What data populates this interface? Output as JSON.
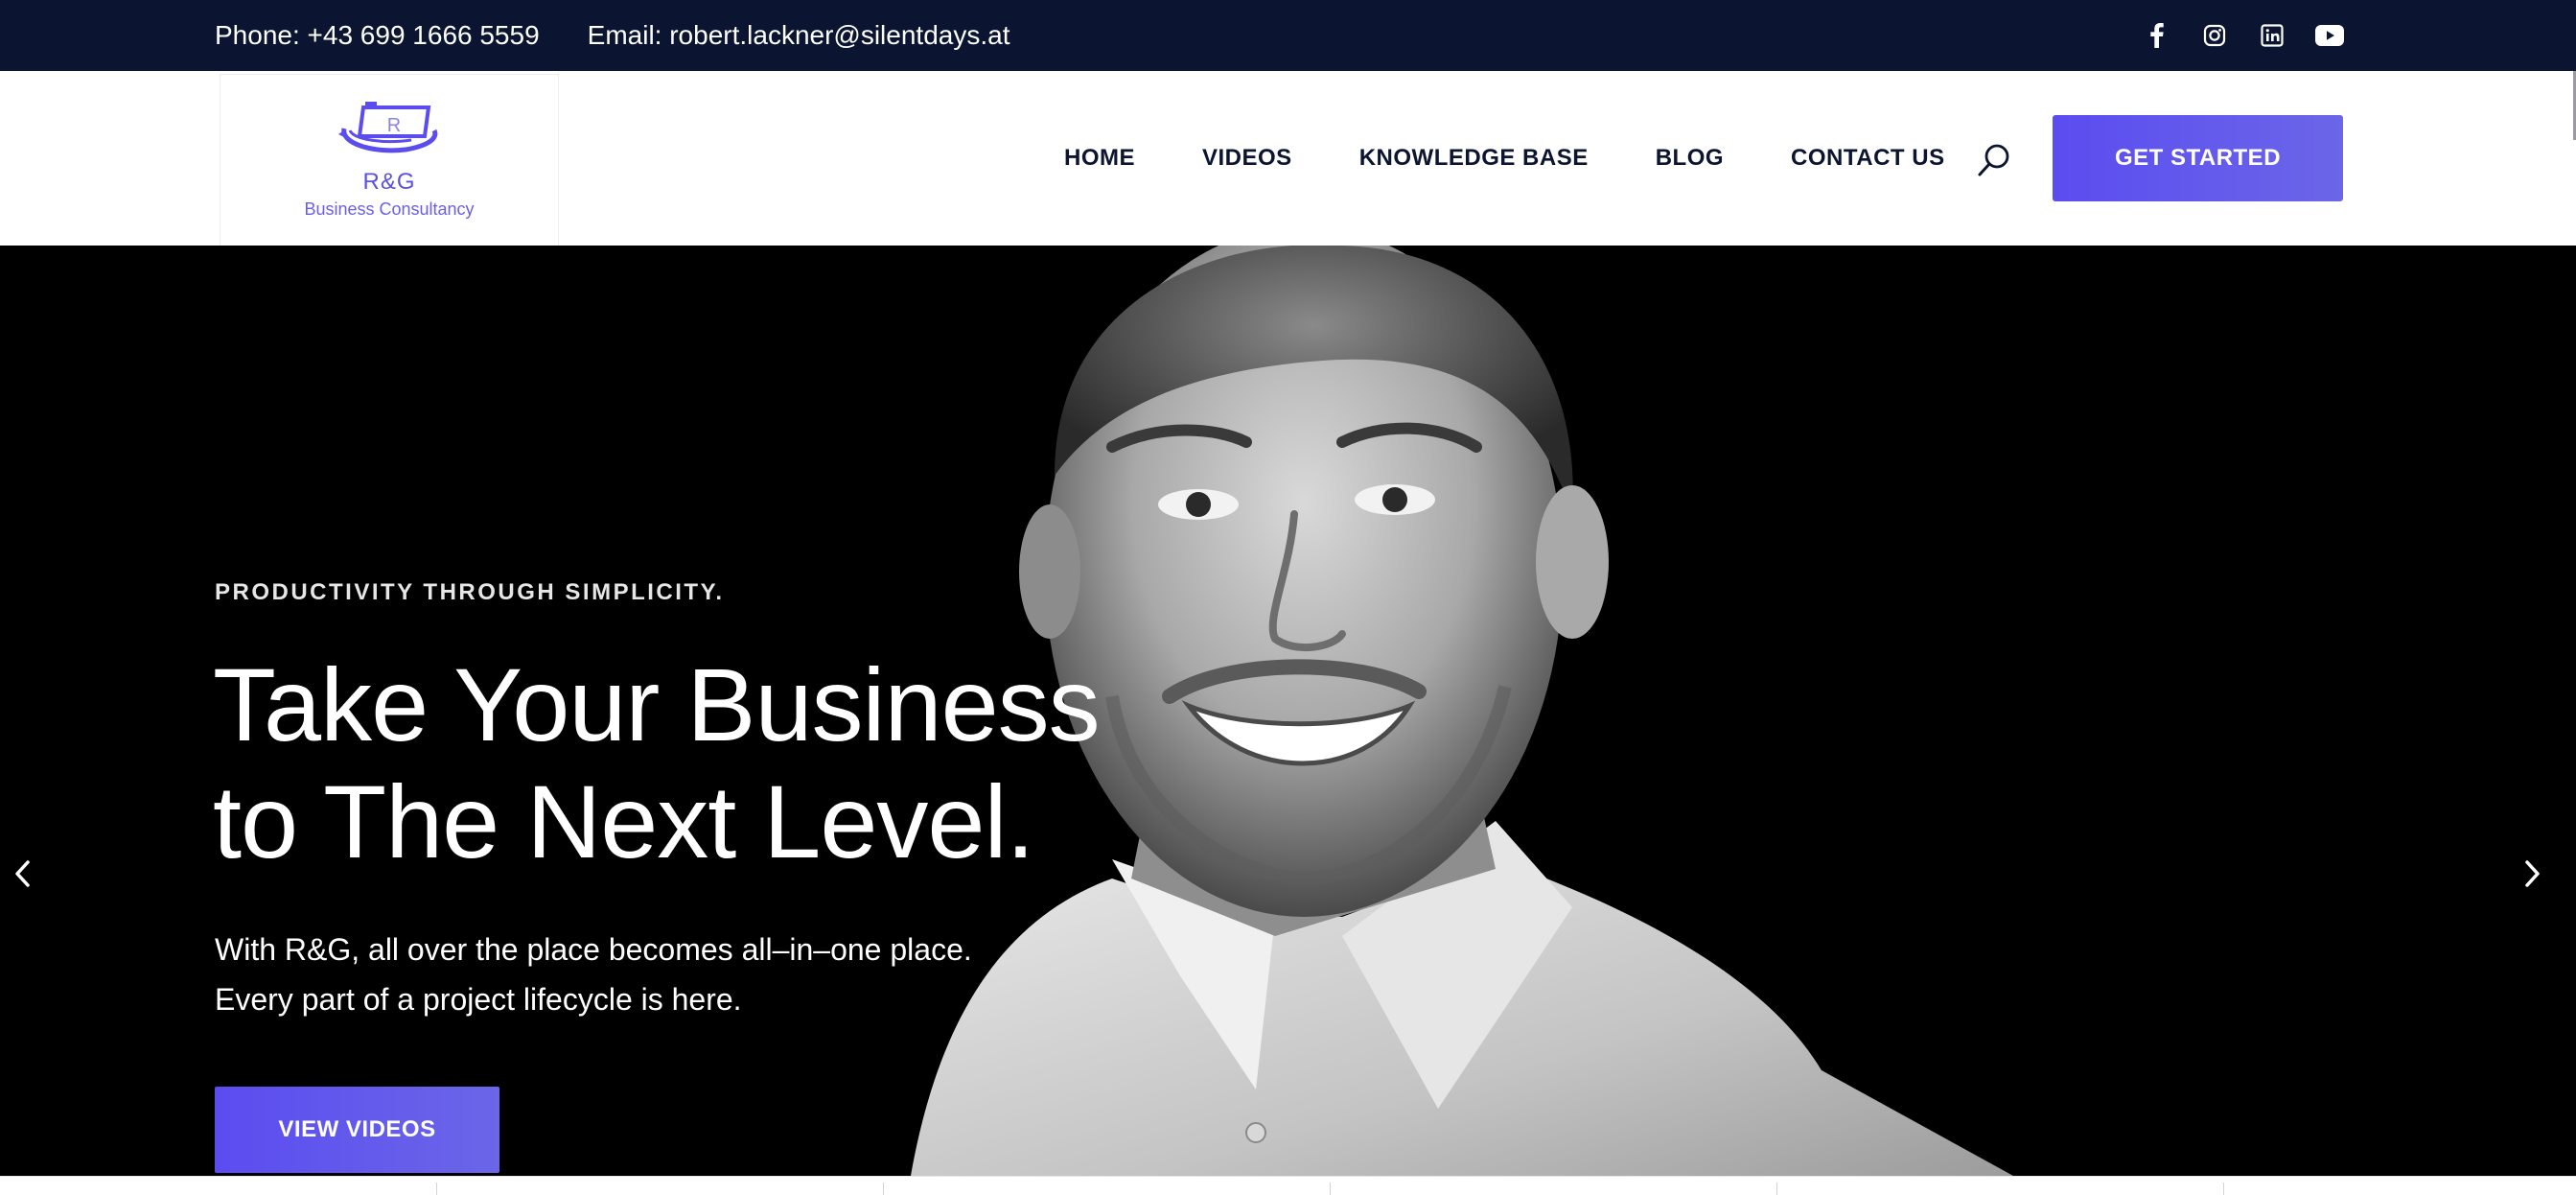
{
  "topbar": {
    "phone": "Phone: +43 699 1666 5559",
    "email": "Email: robert.lackner@silentdays.at",
    "social": [
      "facebook-icon",
      "instagram-icon",
      "linkedin-icon",
      "youtube-icon"
    ]
  },
  "logo": {
    "mark_letter": "R",
    "name": "R&G",
    "subtitle": "Business Consultancy"
  },
  "nav": {
    "items": [
      "HOME",
      "VIDEOS",
      "KNOWLEDGE BASE",
      "BLOG",
      "CONTACT US"
    ],
    "search_icon": "search-icon",
    "cta_label": "GET STARTED"
  },
  "hero": {
    "eyebrow": "PRODUCTIVITY THROUGH SIMPLICITY.",
    "headline_line1": "Take Your Business",
    "headline_line2": "to The Next Level.",
    "sub_line1": "With R&G, all over the place becomes all–in–one place.",
    "sub_line2": "Every part of a project lifecycle is here.",
    "button_label": "VIEW VIDEOS",
    "prev_icon": "chevron-left-icon",
    "next_icon": "chevron-right-icon"
  },
  "colors": {
    "topbar_bg": "#0b1430",
    "accent": "#5b4cf0",
    "nav_text": "#0b1430",
    "hero_bg": "#000000"
  }
}
